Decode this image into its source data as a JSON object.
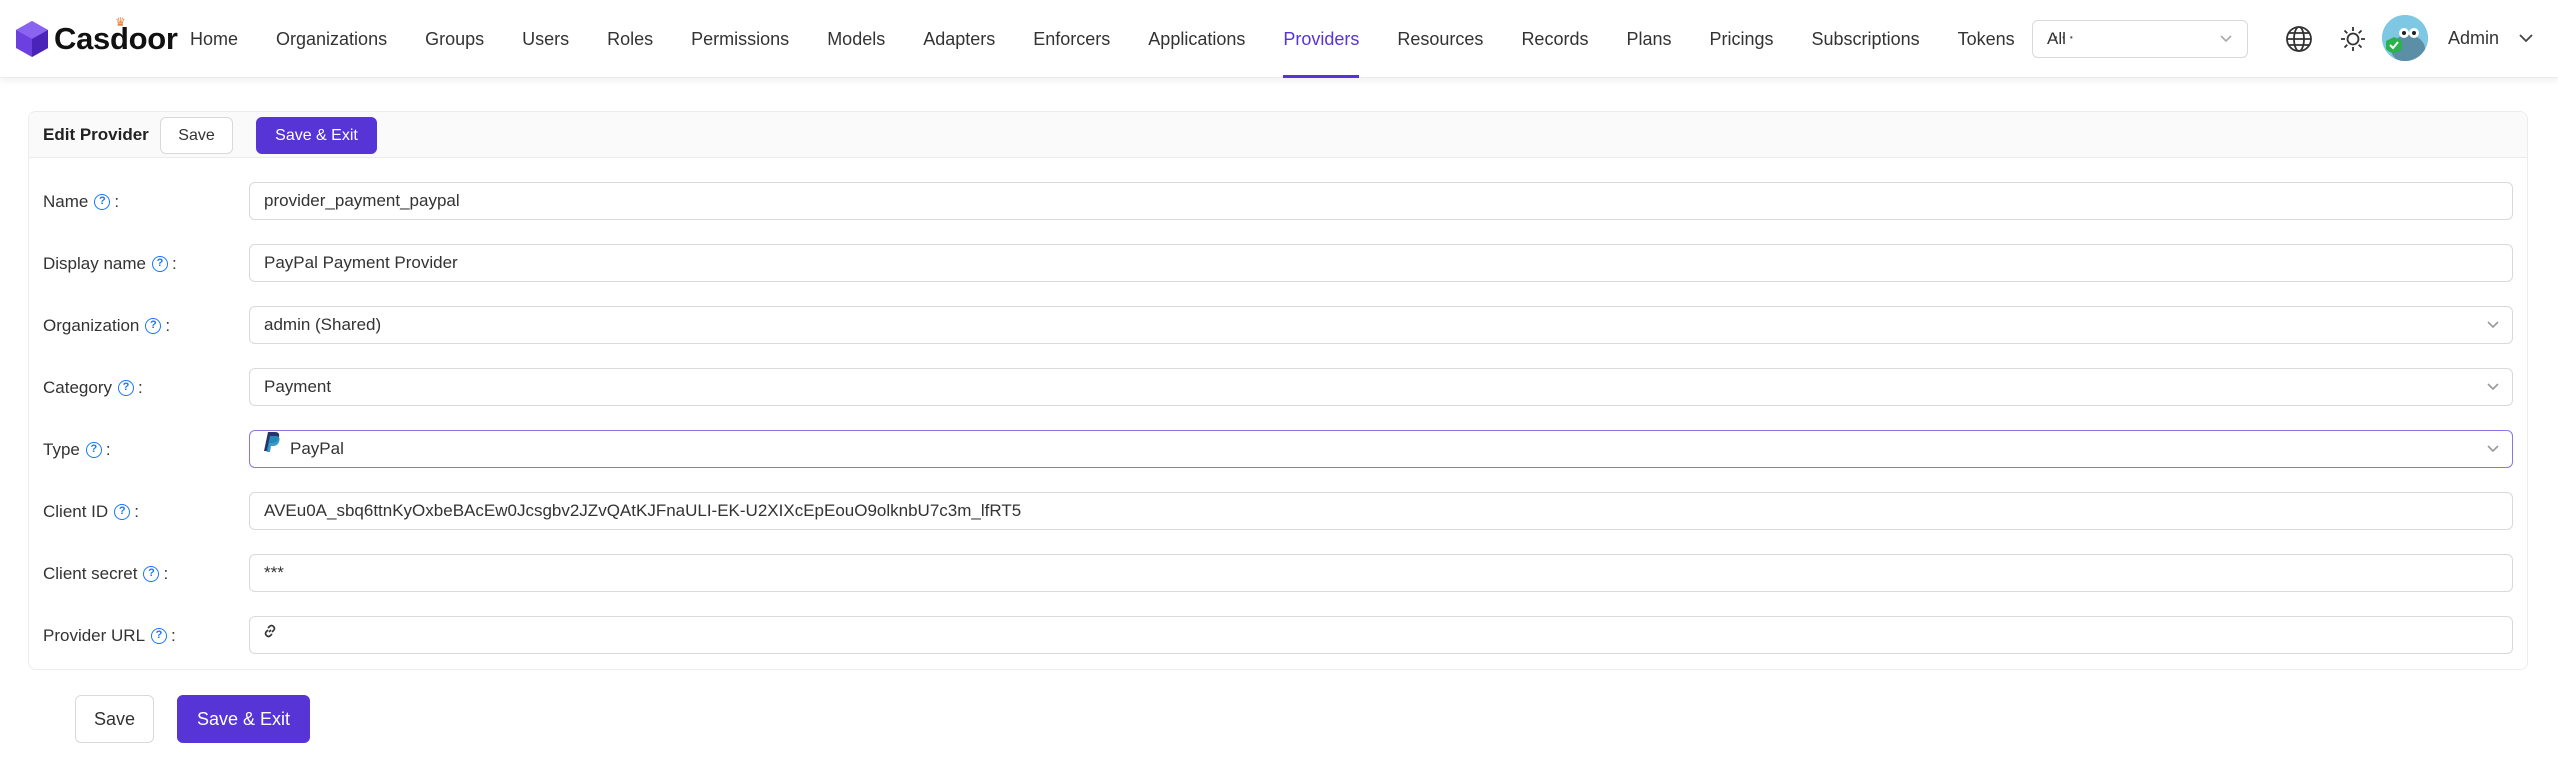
{
  "app": {
    "logo_text": "Casdoor"
  },
  "nav": {
    "items": [
      {
        "label": "Home",
        "active": false
      },
      {
        "label": "Organizations",
        "active": false
      },
      {
        "label": "Groups",
        "active": false
      },
      {
        "label": "Users",
        "active": false
      },
      {
        "label": "Roles",
        "active": false
      },
      {
        "label": "Permissions",
        "active": false
      },
      {
        "label": "Models",
        "active": false
      },
      {
        "label": "Adapters",
        "active": false
      },
      {
        "label": "Enforcers",
        "active": false
      },
      {
        "label": "Applications",
        "active": false
      },
      {
        "label": "Providers",
        "active": true
      },
      {
        "label": "Resources",
        "active": false
      },
      {
        "label": "Records",
        "active": false
      },
      {
        "label": "Plans",
        "active": false
      },
      {
        "label": "Pricings",
        "active": false
      },
      {
        "label": "Subscriptions",
        "active": false
      },
      {
        "label": "Tokens",
        "active": false
      }
    ],
    "more": "···"
  },
  "header": {
    "org_selector": "All",
    "user_name": "Admin",
    "accent_color": "#5734d6"
  },
  "card": {
    "title": "Edit Provider",
    "save_label": "Save",
    "save_exit_label": "Save & Exit"
  },
  "form": {
    "name": {
      "label": "Name",
      "value": "provider_payment_paypal"
    },
    "display_name": {
      "label": "Display name",
      "value": "PayPal Payment Provider"
    },
    "organization": {
      "label": "Organization",
      "value": "admin (Shared)"
    },
    "category": {
      "label": "Category",
      "value": "Payment"
    },
    "type": {
      "label": "Type",
      "value": "PayPal"
    },
    "client_id": {
      "label": "Client ID",
      "value": "AVEu0A_sbq6ttnKyOxbeBAcEw0Jcsgbv2JZvQAtKJFnaULI-EK-U2XIXcEpEouO9olknbU7c3m_lfRT5"
    },
    "client_secret": {
      "label": "Client secret",
      "value": "***"
    },
    "provider_url": {
      "label": "Provider URL",
      "value": ""
    }
  },
  "bottom": {
    "save_label": "Save",
    "save_exit_label": "Save & Exit"
  }
}
